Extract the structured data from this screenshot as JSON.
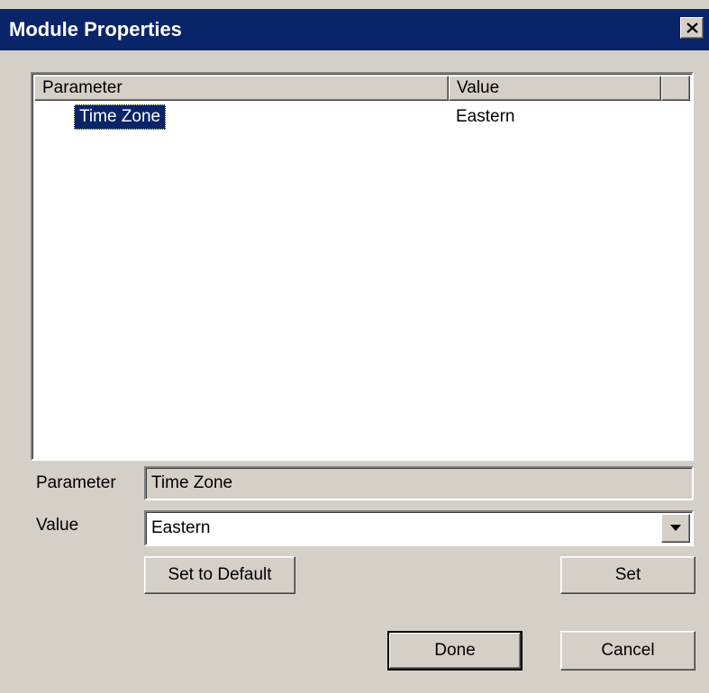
{
  "window": {
    "title": "Module Properties",
    "close_symbol": "×"
  },
  "list": {
    "columns": [
      "Parameter",
      "Value"
    ],
    "rows": [
      {
        "parameter": "Time Zone",
        "value": "Eastern",
        "selected": true
      }
    ]
  },
  "fields": {
    "parameter_label": "Parameter",
    "parameter_value": "Time Zone",
    "value_label": "Value",
    "value_selected": "Eastern"
  },
  "buttons": {
    "set_to_default": "Set to Default",
    "set": "Set",
    "done": "Done",
    "cancel": "Cancel"
  },
  "colors": {
    "titlebar": "#0a246a",
    "face": "#d4d0c8",
    "selection": "#0a246a"
  },
  "icons": {
    "close": "close-icon",
    "dropdown": "chevron-down-icon"
  }
}
